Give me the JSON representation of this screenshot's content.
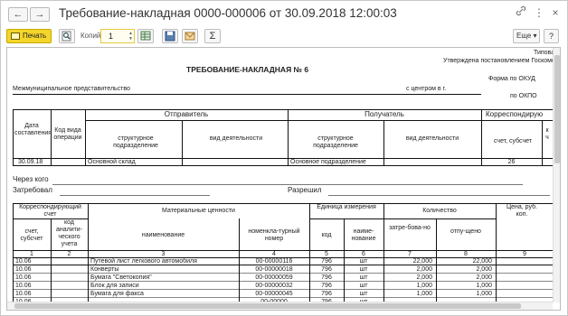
{
  "window": {
    "back": "←",
    "forward": "→",
    "title": "Требование-накладная 0000-000006 от 30.09.2018 12:00:03",
    "link_icon": "link-icon",
    "menu_icon": "kebab-icon",
    "close": "×"
  },
  "toolbar": {
    "print": "Печать",
    "copies_label": "Копий:",
    "copies_value": "1",
    "sum_icon": "Σ",
    "more": "Еще ▾",
    "help": "?"
  },
  "doc": {
    "form_type": "Типовая м",
    "approved": "Утверждена постановлением Госкомс",
    "title": "ТРЕБОВАНИЕ-НАКЛАДНАЯ № 6",
    "okud_label": "Форма по ОКУД",
    "org": "Межмуниципальное представительство",
    "org_suffix": "с центром в г.",
    "okpo_label": "по ОКПО",
    "head": {
      "date": "Дата составления",
      "op_code": "Код вида операции",
      "sender": "Отправитель",
      "receiver": "Получатель",
      "corr": "Корреспондирую",
      "struct_unit": "структурное подразделение",
      "activity": "вид деятельности",
      "account": "счет, субсчет",
      "k": "к ч"
    },
    "head_values": {
      "date": "30.09.18",
      "sender_unit": "Основной склад",
      "receiver_unit": "Основное подразделение",
      "account": "26"
    },
    "through": "Через кого",
    "requested": "Затребовал",
    "allowed": "Разрешил",
    "table": {
      "corr_account": "Корреспондирующий счет",
      "mat_values": "Материальные ценности",
      "unit": "Единица измерения",
      "quantity": "Количество",
      "price": "Цена, руб. коп.",
      "account": "счет, субсчет",
      "analytic": "код аналити-ческого учета",
      "name": "наименование",
      "item_no": "номенкла-турный номер",
      "code": "код",
      "unit_name": "наиме-нование",
      "requested": "затре-бова-но",
      "released": "отпу-щено",
      "numbers": [
        "1",
        "2",
        "3",
        "4",
        "5",
        "6",
        "7",
        "8",
        "9"
      ],
      "rows": [
        {
          "acc": "10.06",
          "name": "Путевой лист легкового автомобиля",
          "num": "00-00000116",
          "code": "796",
          "unit": "шт",
          "req": "22,000",
          "rel": "22,000"
        },
        {
          "acc": "10.06",
          "name": "Конверты",
          "num": "00-00000018",
          "code": "796",
          "unit": "шт",
          "req": "2,000",
          "rel": "2,000"
        },
        {
          "acc": "10.06",
          "name": "Бумага \"Светокопия\"",
          "num": "00-00000059",
          "code": "796",
          "unit": "шт",
          "req": "2,000",
          "rel": "2,000"
        },
        {
          "acc": "10.06",
          "name": "Блок для записи",
          "num": "00-00000032",
          "code": "796",
          "unit": "шт",
          "req": "1,000",
          "rel": "1,000"
        },
        {
          "acc": "10.06",
          "name": "Бумага для факса",
          "num": "00-00000045",
          "code": "796",
          "unit": "шт",
          "req": "1,000",
          "rel": "1,000"
        },
        {
          "acc": "10.06",
          "name": "",
          "num": "00-00000",
          "code": "796",
          "unit": "шт",
          "req": "",
          "rel": ""
        }
      ]
    }
  }
}
